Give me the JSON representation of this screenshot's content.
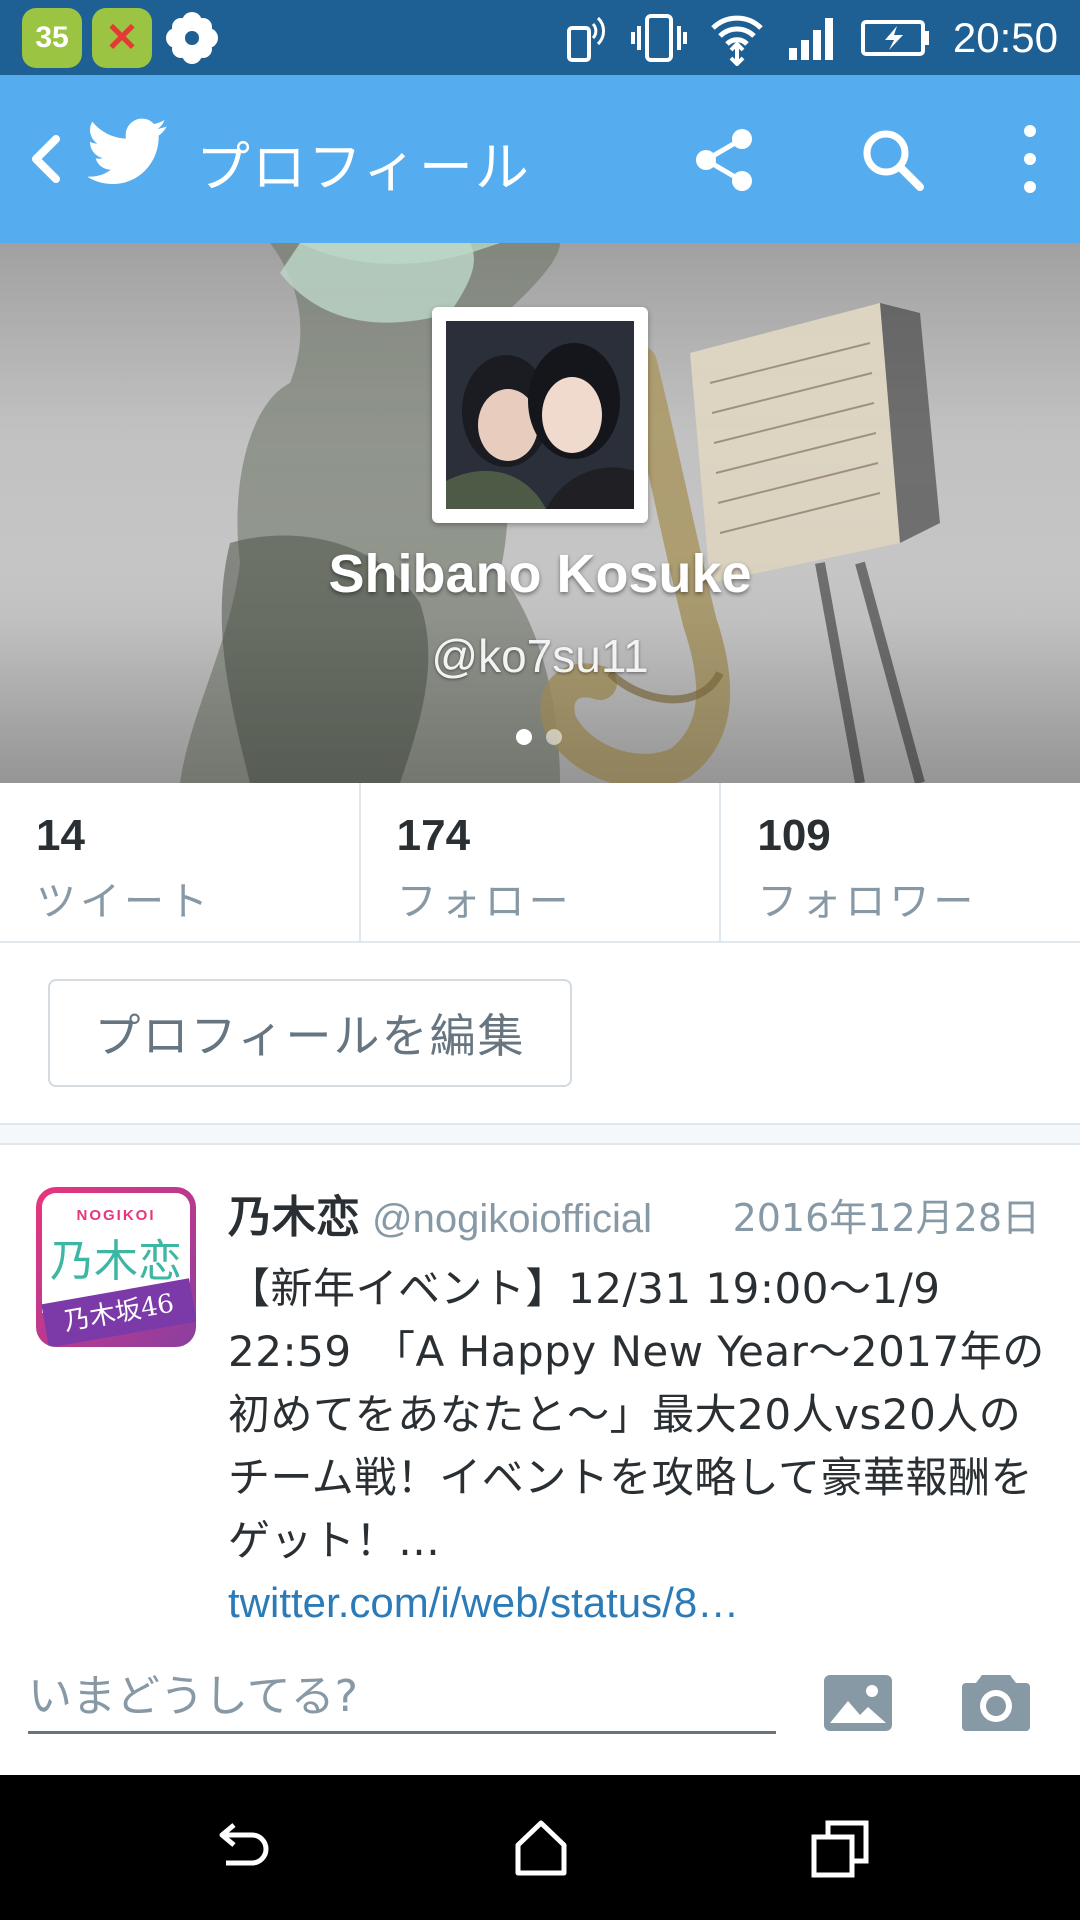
{
  "status_bar": {
    "notification_badge": "35",
    "time": "20:50",
    "icons": [
      "android-badge-icon",
      "android-error-icon",
      "flower-icon",
      "phone-signal-icon",
      "vibrate-icon",
      "wifi-icon",
      "cell-signal-icon",
      "battery-charging-icon"
    ]
  },
  "app_bar": {
    "title": "プロフィール",
    "icons": [
      "back-icon",
      "twitter-bird-icon",
      "share-icon",
      "search-icon",
      "more-vert-icon"
    ],
    "color": "#55acee"
  },
  "profile": {
    "name": "Shibano  Kosuke",
    "handle": "@ko7su11",
    "page_indicator": {
      "pages": 2,
      "active": 1
    }
  },
  "stats": [
    {
      "value": "14",
      "label": "ツイート"
    },
    {
      "value": "174",
      "label": "フォロー"
    },
    {
      "value": "109",
      "label": "フォロワー"
    }
  ],
  "edit_profile_label": "プロフィールを編集",
  "tweet": {
    "avatar_brand": "NOGIKOI",
    "avatar_kanji": "乃木恋",
    "avatar_band": "乃木坂46",
    "author_name": "乃木恋",
    "author_handle": "@nogikoiofficial",
    "date": "2016年12月28日",
    "text": "【新年イベント】12/31 19:00〜1/9 22:59　「A Happy New Year〜2017年の初めてをあなたと〜」最大20人vs20人のチーム戦！イベントを攻略して豪華報酬をゲット！…",
    "link": "twitter.com/i/web/status/8…",
    "link_color": "#2b7bb9"
  },
  "compose": {
    "placeholder": "いまどうしてる?",
    "icons": [
      "photo-icon",
      "camera-icon"
    ]
  },
  "nav_bar": {
    "icons": [
      "nav-back-icon",
      "nav-home-icon",
      "nav-recents-icon"
    ]
  }
}
